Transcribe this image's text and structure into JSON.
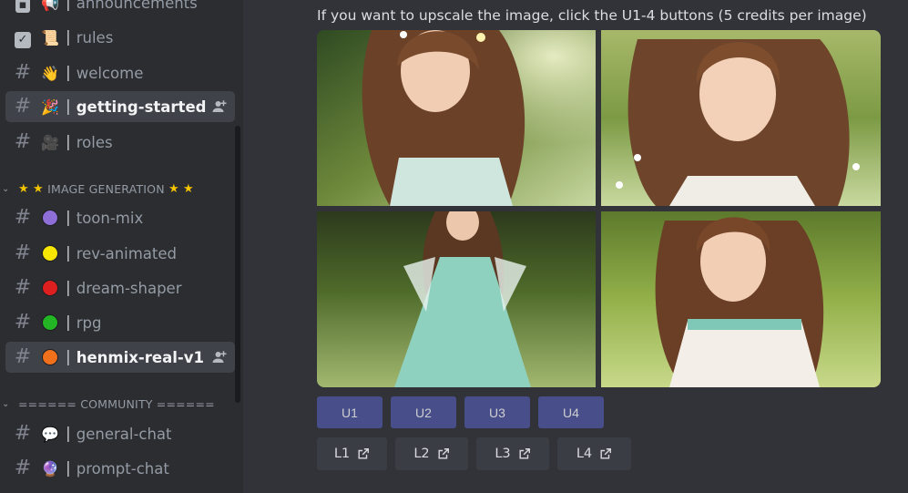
{
  "sidebar": {
    "channels": [
      {
        "name": "announcements",
        "icon": "megaphone-icon",
        "emoji": "📢",
        "active": false
      },
      {
        "name": "rules",
        "icon": "scroll-icon",
        "emoji": "📜",
        "active": false
      },
      {
        "name": "welcome",
        "icon": "waving-hand-icon",
        "emoji": "👋",
        "active": false
      },
      {
        "name": "getting-started",
        "icon": "party-popper-icon",
        "emoji": "🎉",
        "active": true
      },
      {
        "name": "roles",
        "icon": "film-projector-icon",
        "emoji": "🎥",
        "active": false
      }
    ],
    "category_image_generation": "IMAGE GENERATION",
    "image_channels": [
      {
        "name": "toon-mix",
        "color": "#8e6fd8"
      },
      {
        "name": "rev-animated",
        "color": "#f7e600"
      },
      {
        "name": "dream-shaper",
        "color": "#dd1f1f"
      },
      {
        "name": "rpg",
        "color": "#23b523"
      },
      {
        "name": "henmix-real-v1",
        "color": "#f0701c",
        "active": true
      }
    ],
    "category_community": "====== COMMUNITY ======",
    "community_channels": [
      {
        "name": "general-chat",
        "icon": "speech-bubble-icon",
        "emoji": "💬"
      },
      {
        "name": "prompt-chat",
        "icon": "crystal-ball-icon",
        "emoji": "🔮"
      }
    ],
    "separator": "|"
  },
  "main": {
    "instruction": "If you want to upscale the image, click the U1-4 buttons  (5 credits per image)",
    "upscale_buttons": [
      "U1",
      "U2",
      "U3",
      "U4"
    ],
    "link_buttons": [
      "L1",
      "L2",
      "L3",
      "L4"
    ]
  },
  "colors": {
    "sidebar_bg": "#2b2d31",
    "main_bg": "#313338",
    "upscale_button": "#4e5bbd",
    "link_button": "#3b3d44"
  }
}
